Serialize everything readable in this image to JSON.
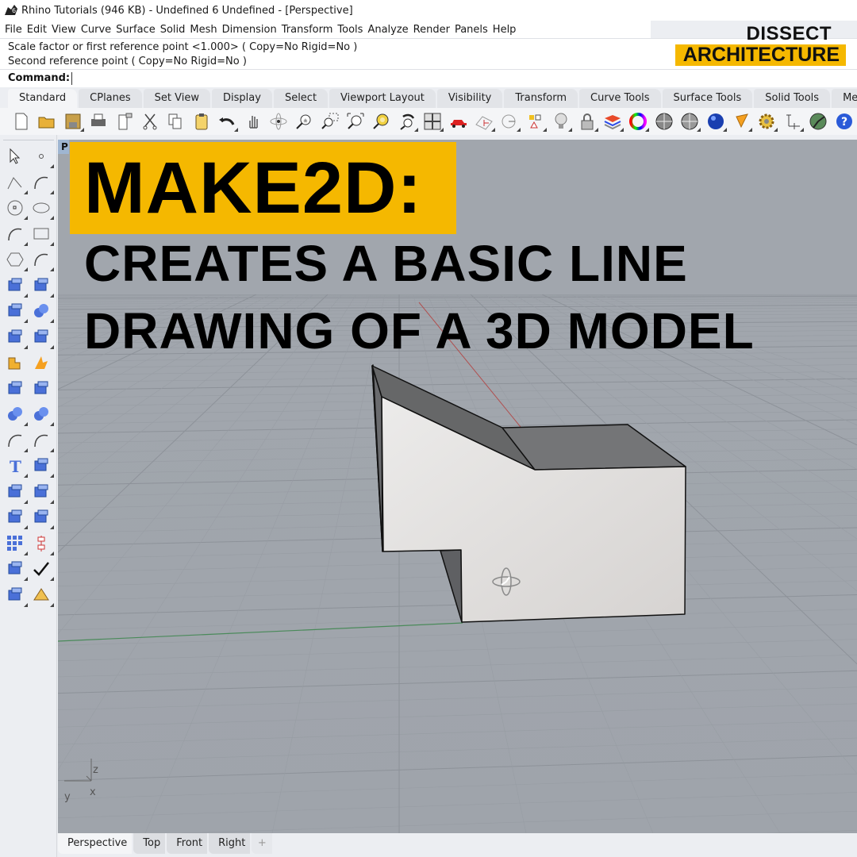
{
  "window": {
    "title": "Rhino Tutorials (946 KB) - Undefined 6 Undefined - [Perspective]"
  },
  "menu": [
    "File",
    "Edit",
    "View",
    "Curve",
    "Surface",
    "Solid",
    "Mesh",
    "Dimension",
    "Transform",
    "Tools",
    "Analyze",
    "Render",
    "Panels",
    "Help"
  ],
  "brand": {
    "line1": "DISSECT",
    "line2": "ARCHITECTURE",
    "accent": "#f5b800"
  },
  "command": {
    "history": [
      "Scale factor or first reference point <1.000> ( Copy=No  Rigid=No )",
      "Second reference point ( Copy=No  Rigid=No )"
    ],
    "prompt_label": "Command:",
    "value": ""
  },
  "toolbar_tabs": [
    "Standard",
    "CPlanes",
    "Set View",
    "Display",
    "Select",
    "Viewport Layout",
    "Visibility",
    "Transform",
    "Curve Tools",
    "Surface Tools",
    "Solid Tools",
    "Mesh Tools"
  ],
  "active_toolbar_tab": "Standard",
  "toolbar_icons": [
    "new-file-icon",
    "open-folder-icon",
    "save-icon",
    "print-icon",
    "import-icon",
    "cut-icon",
    "copy-icon",
    "paste-icon",
    "undo-icon",
    "pan-icon",
    "rotate-view-icon",
    "zoom-dynamic-icon",
    "zoom-window-icon",
    "zoom-extents-icon",
    "zoom-selected-icon",
    "undo-view-icon",
    "four-viewports-icon",
    "car-icon",
    "grid-icon",
    "cplane-icon",
    "object-snap-icon",
    "light-bulb-icon",
    "lock-icon",
    "layer-icon",
    "color-wheel-icon",
    "shaded-sphere-icon",
    "wireframe-sphere-icon",
    "rendered-sphere-icon",
    "cone-light-icon",
    "options-gear-icon",
    "dimension-icon",
    "analyze-icon",
    "help-icon"
  ],
  "left_tools": [
    [
      "select-arrow-icon",
      "point-icon"
    ],
    [
      "polyline-icon",
      "curve-icon"
    ],
    [
      "circle-icon",
      "ellipse-icon"
    ],
    [
      "arc-icon",
      "rectangle-icon"
    ],
    [
      "polygon-icon",
      "fillet-curve-icon"
    ],
    [
      "surface-corners-icon",
      "extrude-surface-icon"
    ],
    [
      "box-icon",
      "sphere-union-icon"
    ],
    [
      "cylinder-icon",
      "mesh-plane-icon"
    ],
    [
      "explode-icon",
      "boolean-split-icon"
    ],
    [
      "trim-icon",
      "split-icon"
    ],
    [
      "group-icon",
      "ungroup-icon"
    ],
    [
      "offset-curve-icon",
      "fillet-edge-icon"
    ],
    [
      "text-icon",
      "move-icon"
    ],
    [
      "array-icon",
      "rotate-object-icon"
    ],
    [
      "solid-edit-icon",
      "project-icon"
    ],
    [
      "grid-array-icon",
      "align-icon"
    ],
    [
      "properties-icon",
      "check-icon"
    ],
    [
      "render-objects-icon",
      "pyramid-icon"
    ]
  ],
  "viewport": {
    "name_initial": "P",
    "axis_labels": {
      "z": "z",
      "y": "y",
      "x": "x"
    }
  },
  "overlay": {
    "headline": "MAKE2D:",
    "line1": "CREATES A BASIC LINE",
    "line2": "DRAWING OF A 3D MODEL"
  },
  "view_tabs": [
    "Perspective",
    "Top",
    "Front",
    "Right"
  ],
  "active_view_tab": "Perspective",
  "add_view_tab_label": "+"
}
